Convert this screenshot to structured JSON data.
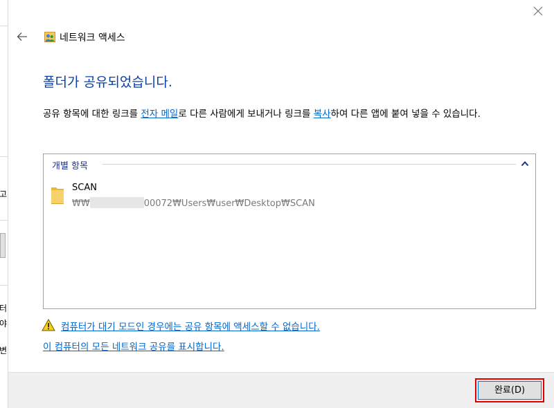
{
  "background_window": {
    "fragments": [
      "고,",
      "터",
      "야",
      "변"
    ]
  },
  "dialog": {
    "window_title": "네트워크 액세스",
    "heading": "폴더가 공유되었습니다.",
    "description": {
      "part1": "공유 항목에 대한 링크를 ",
      "email_link": "전자 메일",
      "part2": "로 다른 사람에게 보내거나 링크를 ",
      "copy_link": "복사",
      "part3": "하여 다른 앱에 붙여 넣을 수 있습니다."
    },
    "shared_items": {
      "group_label": "개별 항목",
      "items": [
        {
          "name": "SCAN",
          "path_prefix": "₩₩",
          "path_suffix": "00072₩Users₩user₩Desktop₩SCAN"
        }
      ]
    },
    "warning_link": "컴퓨터가 대기 모드인 경우에는 공유 항목에 액세스할 수 없습니다.",
    "show_all_link": "이 컴퓨터의 모든 네트워크 공유를 표시합니다.",
    "done_button": "완료(D)"
  },
  "colors": {
    "heading": "#0a3fa6",
    "link": "#0066cc",
    "group_label": "#1e3287",
    "highlight_box": "#e00000"
  },
  "icons": {
    "close": "close-icon",
    "back": "back-arrow-icon",
    "title": "network-users-icon",
    "collapse": "chevron-up-icon",
    "folder": "folder-icon",
    "warning": "warning-icon"
  }
}
